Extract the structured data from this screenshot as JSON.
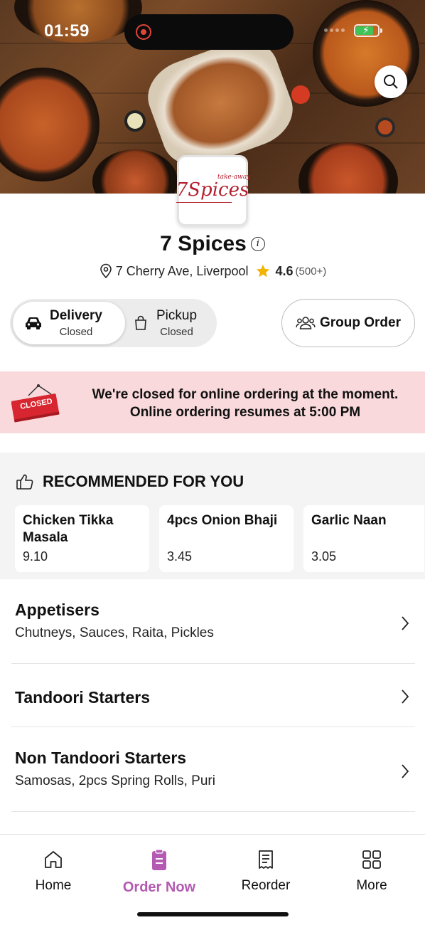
{
  "status_bar": {
    "time": "01:59"
  },
  "restaurant": {
    "logo_text_main": "7Spices",
    "logo_text_small": "take-away",
    "name": "7 Spices",
    "address": "7 Cherry Ave, Liverpool",
    "rating": "4.6",
    "rating_count": "(500+)"
  },
  "order_type": {
    "delivery": {
      "label": "Delivery",
      "status": "Closed"
    },
    "pickup": {
      "label": "Pickup",
      "status": "Closed"
    }
  },
  "group_order_label": "Group Order",
  "closed_banner": {
    "sign_text": "CLOSED",
    "line1": "We're closed for online ordering at the moment.",
    "line2": "Online ordering resumes at 5:00 PM"
  },
  "recommended": {
    "title": "RECOMMENDED FOR YOU",
    "items": [
      {
        "name": "Chicken Tikka Masala",
        "price": "9.10"
      },
      {
        "name": "4pcs Onion Bhaji",
        "price": "3.45"
      },
      {
        "name": "Garlic Naan",
        "price": "3.05"
      }
    ]
  },
  "categories": [
    {
      "title": "Appetisers",
      "subtitle": "Chutneys, Sauces, Raita, Pickles"
    },
    {
      "title": "Tandoori Starters",
      "subtitle": ""
    },
    {
      "title": "Non Tandoori Starters",
      "subtitle": "Samosas, 2pcs Spring Rolls, Puri"
    }
  ],
  "tabs": [
    {
      "label": "Home",
      "icon": "home-icon"
    },
    {
      "label": "Order Now",
      "icon": "order-icon"
    },
    {
      "label": "Reorder",
      "icon": "receipt-icon"
    },
    {
      "label": "More",
      "icon": "grid-icon"
    }
  ],
  "colors": {
    "accent": "#b45ab2",
    "closed_banner_bg": "#f9d9dc",
    "closed_sign": "#d7262f",
    "star": "#f2b400"
  }
}
